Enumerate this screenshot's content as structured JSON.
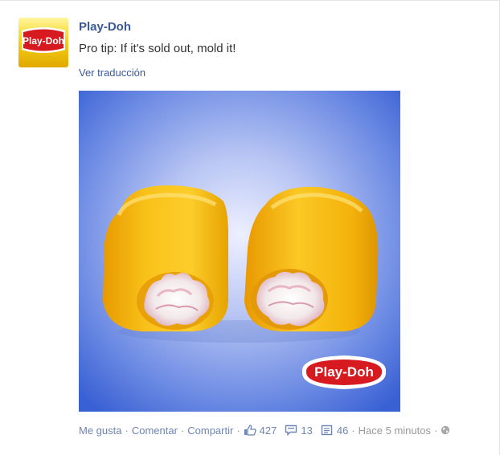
{
  "post": {
    "page_name": "Play-Doh",
    "text": "Pro tip: If it's sold out, mold it!",
    "translate_label": "Ver traducción",
    "avatar_logo_text": "Play-Doh",
    "image_logo_text": "Play-Doh"
  },
  "actions": {
    "like_label": "Me gusta",
    "comment_label": "Comentar",
    "share_label": "Compartir",
    "separator": "·",
    "likes_count": "427",
    "comments_count": "13",
    "shares_count": "46",
    "timestamp": "Hace 5 minutos"
  },
  "colors": {
    "link": "#3b5998",
    "muted_link": "#6d84b4",
    "image_background": "#3f66d6",
    "dough_yellow": "#f7b80b",
    "brand_red": "#d71920"
  }
}
